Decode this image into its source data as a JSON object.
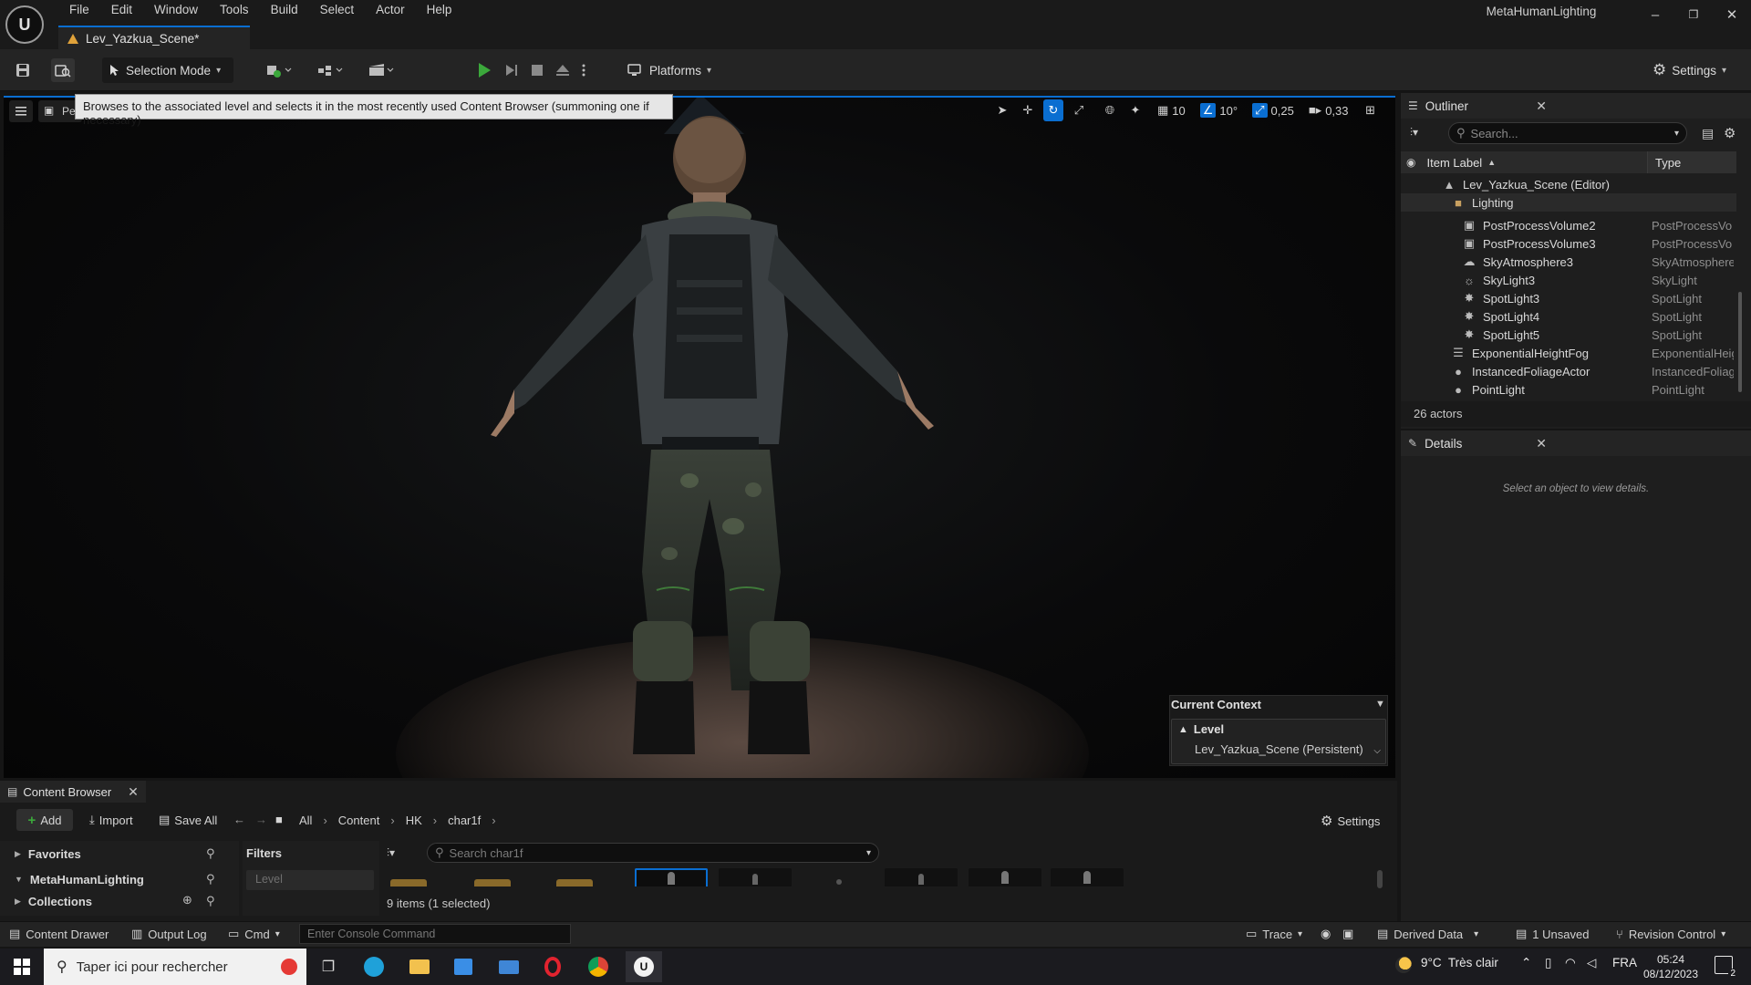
{
  "app": {
    "title": "MetaHumanLighting",
    "menu": [
      "File",
      "Edit",
      "Window",
      "Tools",
      "Build",
      "Select",
      "Actor",
      "Help"
    ],
    "document_tab": "Lev_Yazkua_Scene*"
  },
  "toolbar": {
    "selection_mode": "Selection Mode",
    "platforms": "Platforms",
    "settings": "Settings"
  },
  "viewport": {
    "tooltip": "Browses to the associated level and selects it in the most recently used Content Browser (summoning one if necessary)",
    "persp_label": "Pe",
    "grid_snap": "10",
    "rotation_snap": "10°",
    "scale_snap": "0,25",
    "camera_speed": "0,33"
  },
  "current_context": {
    "title": "Current Context",
    "level_label": "Level",
    "scene": "Lev_Yazkua_Scene (Persistent)"
  },
  "outliner": {
    "tab": "Outliner",
    "search_placeholder": "Search...",
    "col_label": "Item Label",
    "col_type": "Type",
    "rows": [
      {
        "label": "Lev_Yazkua_Scene (Editor)",
        "type": ""
      },
      {
        "label": "Lighting",
        "type": ""
      },
      {
        "label": "PostProcessVolume2",
        "type": "PostProcessVo"
      },
      {
        "label": "PostProcessVolume3",
        "type": "PostProcessVo"
      },
      {
        "label": "SkyAtmosphere3",
        "type": "SkyAtmosphere"
      },
      {
        "label": "SkyLight3",
        "type": "SkyLight"
      },
      {
        "label": "SpotLight3",
        "type": "SpotLight"
      },
      {
        "label": "SpotLight4",
        "type": "SpotLight"
      },
      {
        "label": "SpotLight5",
        "type": "SpotLight"
      },
      {
        "label": "ExponentialHeightFog",
        "type": "ExponentialHeig"
      },
      {
        "label": "InstancedFoliageActor",
        "type": "InstancedFoliag"
      },
      {
        "label": "PointLight",
        "type": "PointLight"
      }
    ],
    "actor_count": "26 actors"
  },
  "details": {
    "tab": "Details",
    "empty_message": "Select an object to view details."
  },
  "content_browser": {
    "tab": "Content Browser",
    "add": "Add",
    "import": "Import",
    "save_all": "Save All",
    "breadcrumbs": [
      "All",
      "Content",
      "HK",
      "char1f"
    ],
    "settings": "Settings",
    "favorites": "Favorites",
    "project": "MetaHumanLighting",
    "collections": "Collections",
    "filters": "Filters",
    "filter_level": "Level",
    "search_placeholder": "Search char1f",
    "item_count": "9 items (1 selected)"
  },
  "statusbar": {
    "content_drawer": "Content Drawer",
    "output_log": "Output Log",
    "cmd": "Cmd",
    "console_placeholder": "Enter Console Command",
    "trace": "Trace",
    "derived_data": "Derived Data",
    "unsaved": "1 Unsaved",
    "revision_control": "Revision Control"
  },
  "taskbar": {
    "search_placeholder": "Taper ici pour rechercher",
    "weather": "9°C  Très clair",
    "lang": "FRA",
    "time": "05:24",
    "date": "08/12/2023",
    "notifications": "2"
  },
  "colors": {
    "accent": "#0a6ed1",
    "play_green": "#3ba83b",
    "level_icon": "#e0a23a"
  }
}
